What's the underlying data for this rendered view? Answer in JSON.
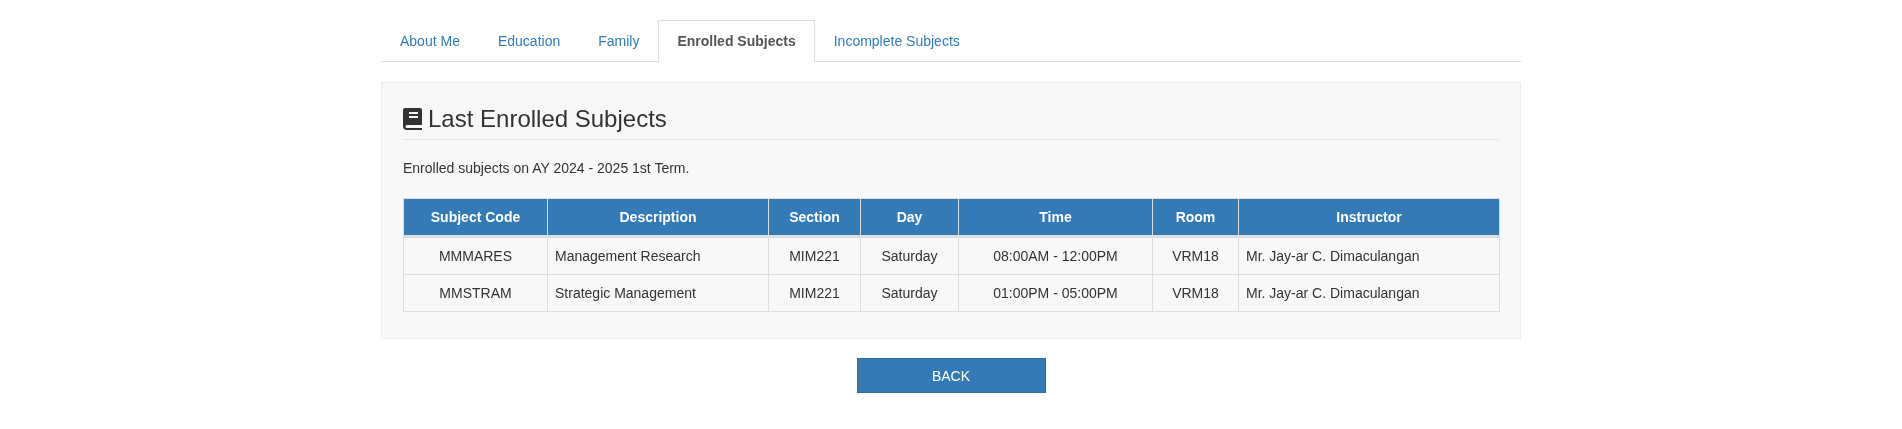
{
  "tabs": [
    {
      "label": "About Me",
      "selected": false
    },
    {
      "label": "Education",
      "selected": false
    },
    {
      "label": "Family",
      "selected": false
    },
    {
      "label": "Enrolled Subjects",
      "selected": true
    },
    {
      "label": "Incomplete Subjects",
      "selected": false
    }
  ],
  "panel": {
    "title": "Last Enrolled Subjects",
    "note": "Enrolled subjects on AY 2024 - 2025 1st Term."
  },
  "table": {
    "columns": [
      "Subject Code",
      "Description",
      "Section",
      "Day",
      "Time",
      "Room",
      "Instructor"
    ],
    "rows": [
      [
        "MMMARES",
        "Management Research",
        "MIM221",
        "Saturday",
        "08:00AM - 12:00PM",
        "VRM18",
        "Mr. Jay-ar C. Dimaculangan"
      ],
      [
        "MMSTRAM",
        "Strategic Management",
        "MIM221",
        "Saturday",
        "01:00PM - 05:00PM",
        "VRM18",
        "Mr. Jay-ar C. Dimaculangan"
      ]
    ]
  },
  "buttons": [
    "BACK"
  ]
}
